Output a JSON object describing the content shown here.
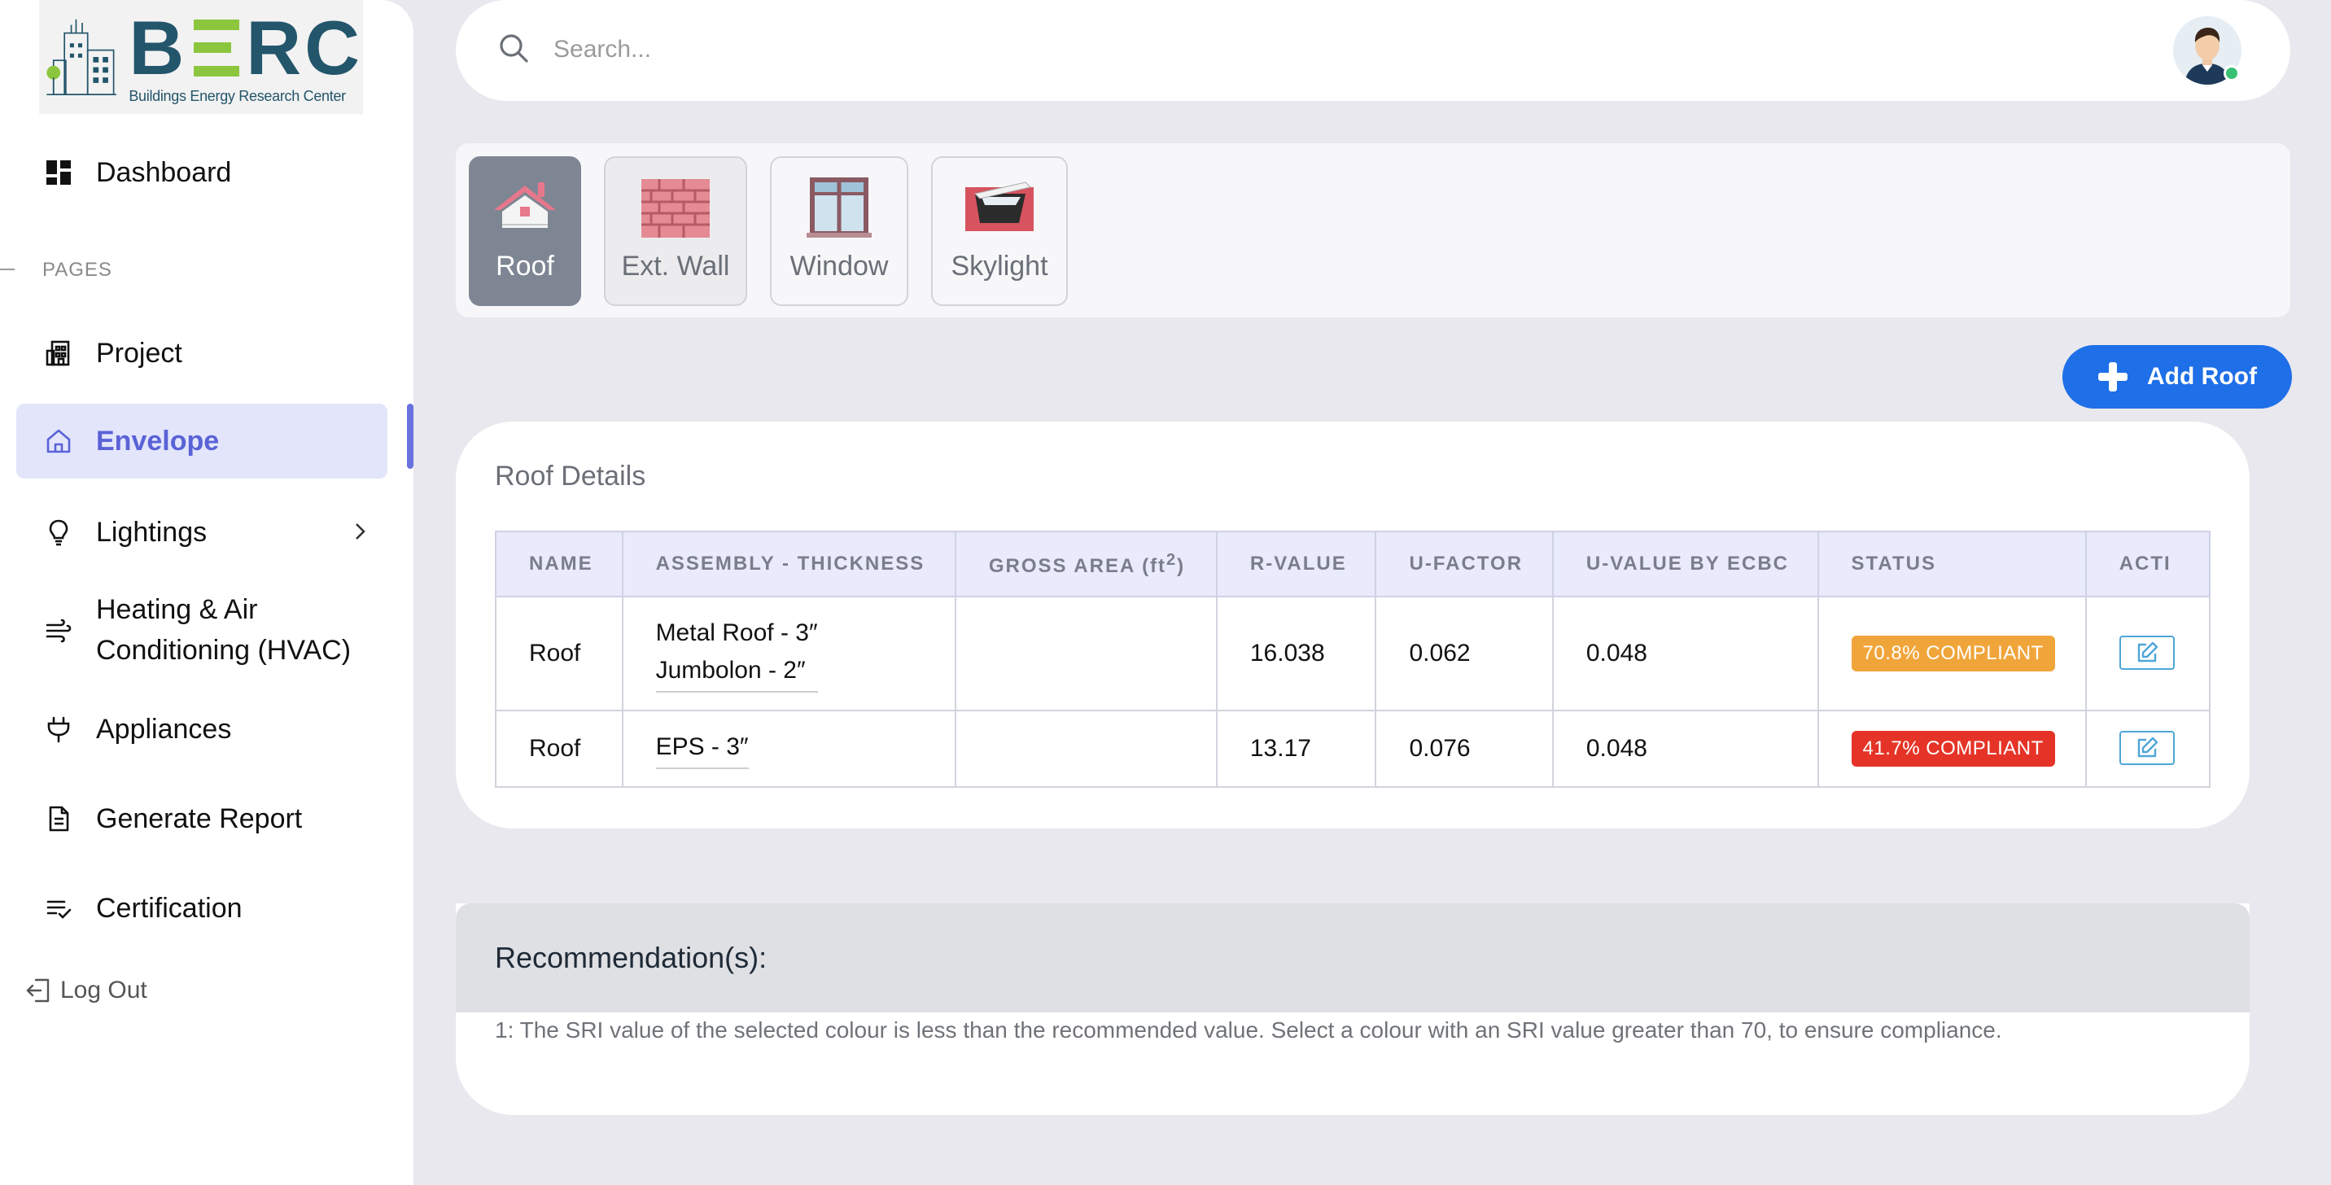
{
  "brand": {
    "name": "BERC",
    "subtitle": "Buildings Energy Research Center"
  },
  "sidebar": {
    "section_label": "PAGES",
    "items": [
      {
        "label": "Dashboard",
        "icon": "dashboard-grid-icon"
      },
      {
        "label": "Project",
        "icon": "building-icon"
      },
      {
        "label": "Envelope",
        "icon": "home-icon",
        "active": true
      },
      {
        "label": "Lightings",
        "icon": "bulb-icon",
        "has_submenu": true
      },
      {
        "label": "Heating & Air Conditioning (HVAC)",
        "icon": "wind-icon"
      },
      {
        "label": "Appliances",
        "icon": "plug-icon"
      },
      {
        "label": "Generate Report",
        "icon": "document-icon"
      },
      {
        "label": "Certification",
        "icon": "checklist-icon"
      }
    ],
    "logout": "Log Out"
  },
  "search": {
    "placeholder": "Search..."
  },
  "tabs": [
    {
      "label": "Roof",
      "icon": "roof-icon",
      "active": true
    },
    {
      "label": "Ext. Wall",
      "icon": "brick-wall-icon"
    },
    {
      "label": "Window",
      "icon": "window-icon"
    },
    {
      "label": "Skylight",
      "icon": "skylight-icon"
    }
  ],
  "add_button": "Add Roof",
  "roof_details": {
    "title": "Roof Details",
    "columns": [
      "NAME",
      "ASSEMBLY - THICKNESS",
      "GROSS AREA (ft",
      "R-VALUE",
      "U-FACTOR",
      "U-VALUE BY ECBC",
      "STATUS",
      "ACTI"
    ],
    "gross_area_sup": "2",
    "gross_area_close": ")",
    "rows": [
      {
        "name": "Roof",
        "assembly": [
          "Metal Roof - 3″",
          "Jumbolon - 2″"
        ],
        "gross_area": "",
        "r_value": "16.038",
        "u_factor": "0.062",
        "u_value_ecbc": "0.048",
        "status": "70.8% COMPLIANT",
        "status_color": "#f0a53a"
      },
      {
        "name": "Roof",
        "assembly": [
          "EPS - 3″"
        ],
        "gross_area": "",
        "r_value": "13.17",
        "u_factor": "0.076",
        "u_value_ecbc": "0.048",
        "status": "41.7% COMPLIANT",
        "status_color": "#e53427"
      }
    ]
  },
  "recommendations": {
    "title": "Recommendation(s):",
    "items": [
      "1: The SRI value of the selected colour is less than the recommended value. Select a colour with an SRI value greater than 70, to ensure compliance."
    ]
  },
  "colors": {
    "primary": "#1e6fe8",
    "active_nav": "#5a62d6",
    "compliant_partial": "#f0a53a",
    "compliant_low": "#e53427"
  }
}
